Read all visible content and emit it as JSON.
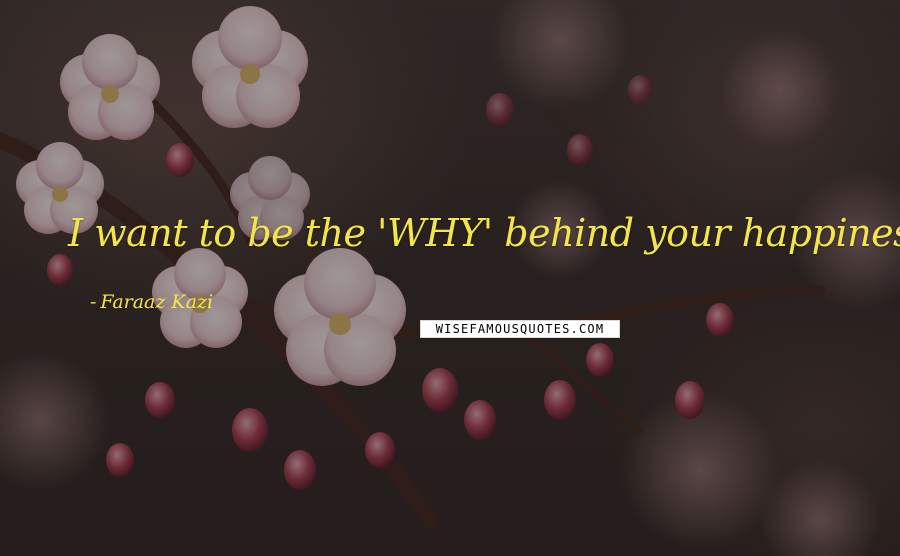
{
  "quote": {
    "text": "I want to be the 'WHY' behind your happiness.",
    "author": "Faraaz Kazi"
  },
  "watermark": {
    "text": "WISEFAMOUSQUOTES.COM"
  },
  "colors": {
    "text_color": "#f4e64a",
    "background_dark": "#2b2422",
    "blossom_pink": "#f3dfe2",
    "bud_crimson": "#8c2a3c"
  },
  "image": {
    "subject": "cherry-blossoms",
    "palette": "dark-moody"
  }
}
